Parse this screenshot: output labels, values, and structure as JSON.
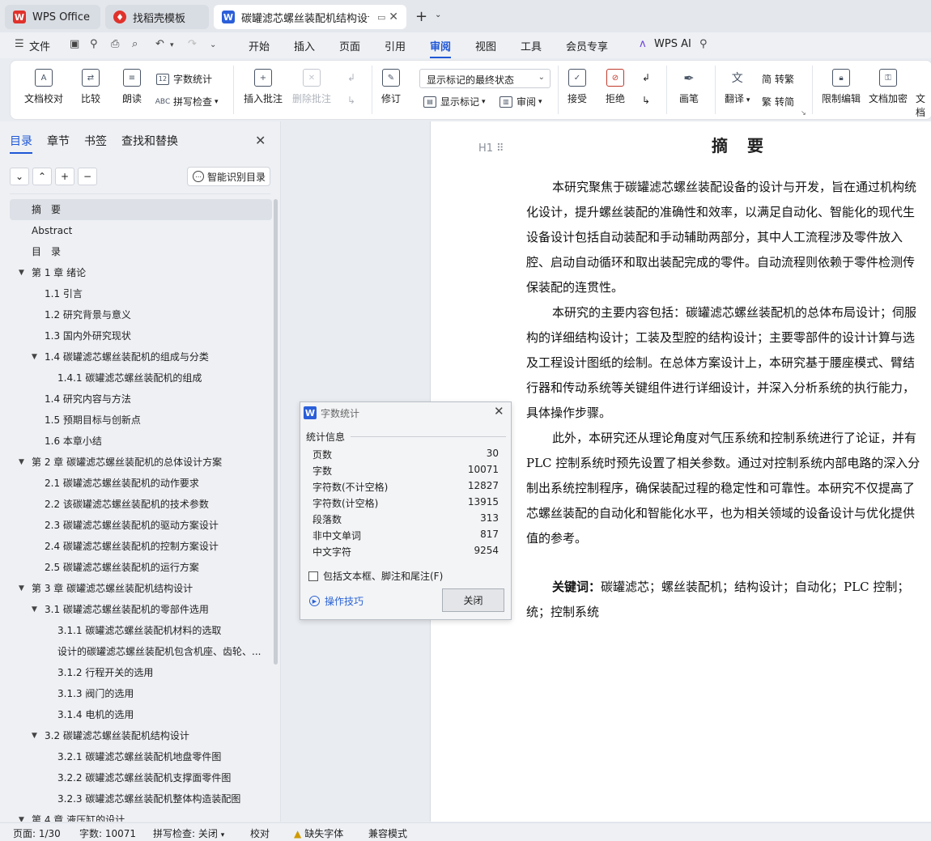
{
  "tabs": [
    {
      "label": "WPS Office",
      "icon": "wps-logo-icon"
    },
    {
      "label": "找稻壳模板",
      "icon": "docer-icon"
    },
    {
      "label": "碳罐滤芯螺丝装配机结构设计",
      "icon": "writer-icon",
      "active": true
    }
  ],
  "menubar": {
    "file": "文件",
    "items": [
      "开始",
      "插入",
      "页面",
      "引用",
      "审阅",
      "视图",
      "工具",
      "会员专享"
    ],
    "active": "审阅",
    "wps_ai": "WPS AI"
  },
  "ribbon": {
    "doc_check": "文档校对",
    "compare": "比较",
    "read_aloud": "朗读",
    "word_count": "字数统计",
    "spell_check": "拼写检查",
    "insert_comment": "插入批注",
    "delete_comment": "删除批注",
    "revise": "修订",
    "markup_state": "显示标记的最终状态",
    "show_markup": "显示标记",
    "review": "审阅",
    "accept": "接受",
    "reject": "拒绝",
    "pen": "画笔",
    "translate": "翻译",
    "trad_to_simp": "转繁",
    "simp_to_trad": "转简",
    "restrict_edit": "限制编辑",
    "doc_encrypt": "文档加密",
    "doc_more": "文档"
  },
  "nav": {
    "tabs": [
      "目录",
      "章节",
      "书签",
      "查找和替换"
    ],
    "active_tab": "目录",
    "smart_toc": "智能识别目录",
    "toc": [
      {
        "label": "摘　要",
        "level": 0,
        "selected": true
      },
      {
        "label": "Abstract",
        "level": 0
      },
      {
        "label": "目　录",
        "level": 0
      },
      {
        "label": "第 1 章  绪论",
        "level": 0,
        "arrow": true
      },
      {
        "label": "1.1  引言",
        "level": 1
      },
      {
        "label": "1.2  研究背景与意义",
        "level": 1
      },
      {
        "label": "1.3  国内外研究现状",
        "level": 1
      },
      {
        "label": "1.4 碳罐滤芯螺丝装配机的组成与分类",
        "level": 1,
        "arrow": true
      },
      {
        "label": "1.4.1 碳罐滤芯螺丝装配机的组成",
        "level": 2
      },
      {
        "label": "1.4  研究内容与方法",
        "level": 1
      },
      {
        "label": "1.5  预期目标与创新点",
        "level": 1
      },
      {
        "label": "1.6  本章小结",
        "level": 1
      },
      {
        "label": "第 2 章  碳罐滤芯螺丝装配机的总体设计方案",
        "level": 0,
        "arrow": true
      },
      {
        "label": "2.1  碳罐滤芯螺丝装配机的动作要求",
        "level": 1
      },
      {
        "label": "2.2 该碳罐滤芯螺丝装配机的技术参数",
        "level": 1
      },
      {
        "label": "2.3 碳罐滤芯螺丝装配机的驱动方案设计",
        "level": 1
      },
      {
        "label": "2.4 碳罐滤芯螺丝装配机的控制方案设计",
        "level": 1
      },
      {
        "label": "2.5 碳罐滤芯螺丝装配机的运行方案",
        "level": 1
      },
      {
        "label": "第 3 章  碳罐滤芯螺丝装配机结构设计",
        "level": 0,
        "arrow": true
      },
      {
        "label": "3.1 碳罐滤芯螺丝装配机的零部件选用",
        "level": 1,
        "arrow": true
      },
      {
        "label": "3.1.1 碳罐滤芯螺丝装配机材料的选取",
        "level": 2
      },
      {
        "label": "设计的碳罐滤芯螺丝装配机包含机座、齿轮、...",
        "level": 2
      },
      {
        "label": "3.1.2 行程开关的选用",
        "level": 2
      },
      {
        "label": "3.1.3 阀门的选用",
        "level": 2
      },
      {
        "label": "3.1.4 电机的选用",
        "level": 2
      },
      {
        "label": "3.2 碳罐滤芯螺丝装配机结构设计",
        "level": 1,
        "arrow": true
      },
      {
        "label": "3.2.1 碳罐滤芯螺丝装配机地盘零件图",
        "level": 2
      },
      {
        "label": "3.2.2 碳罐滤芯螺丝装配机支撑面零件图",
        "level": 2
      },
      {
        "label": "3.2.3 碳罐滤芯螺丝装配机整体构造装配图",
        "level": 2
      },
      {
        "label": "第 4 章  液压缸的设计",
        "level": 0,
        "arrow": true
      }
    ]
  },
  "document": {
    "heading_mark": "H1",
    "title": "摘　要",
    "p1": [
      "本研究聚焦于碳罐滤芯螺丝装配设备的设计与开发，旨在通过机构统",
      "化设计，提升螺丝装配的准确性和效率，以满足自动化、智能化的现代生",
      "设备设计包括自动装配和手动辅助两部分，其中人工流程涉及零件放入",
      "腔、启动自动循环和取出装配完成的零件。自动流程则依赖于零件检测传",
      "保装配的连贯性。"
    ],
    "p2": [
      "本研究的主要内容包括：碳罐滤芯螺丝装配机的总体布局设计；伺服",
      "构的详细结构设计；工装及型腔的结构设计；主要零部件的设计计算与选",
      "及工程设计图纸的绘制。在总体方案设计上，本研究基于腰座模式、臂结",
      "行器和传动系统等关键组件进行详细设计，并深入分析系统的执行能力，",
      "具体操作步骤。"
    ],
    "p3": [
      "此外，本研究还从理论角度对气压系统和控制系统进行了论证，并有",
      "PLC 控制系统时预先设置了相关参数。通过对控制系统内部电路的深入分",
      "制出系统控制程序，确保装配过程的稳定性和可靠性。本研究不仅提高了",
      "芯螺丝装配的自动化和智能化水平，也为相关领域的设备设计与优化提供",
      "值的参考。"
    ],
    "keywords_label": "关键词：",
    "keywords_line1": "碳罐滤芯；螺丝装配机；结构设计；自动化；PLC 控制；",
    "keywords_line2": "统；控制系统"
  },
  "dialog": {
    "title": "字数统计",
    "section": "统计信息",
    "stats": [
      {
        "label": "页数",
        "value": "30"
      },
      {
        "label": "字数",
        "value": "10071"
      },
      {
        "label": "字符数(不计空格)",
        "value": "12827"
      },
      {
        "label": "字符数(计空格)",
        "value": "13915"
      },
      {
        "label": "段落数",
        "value": "313"
      },
      {
        "label": "非中文单词",
        "value": "817"
      },
      {
        "label": "中文字符",
        "value": "9254"
      }
    ],
    "checkbox": "包括文本框、脚注和尾注(F)",
    "tips": "操作技巧",
    "close": "关闭"
  },
  "status": {
    "page": "页面: 1/30",
    "words": "字数: 10071",
    "spell": "拼写检查: 关闭",
    "proof": "校对",
    "missing_font": "缺失字体",
    "compat": "兼容模式"
  },
  "colors": {
    "accent": "#1f57d6",
    "wps_red": "#e0322b",
    "writer_blue": "#2b5fd9"
  }
}
